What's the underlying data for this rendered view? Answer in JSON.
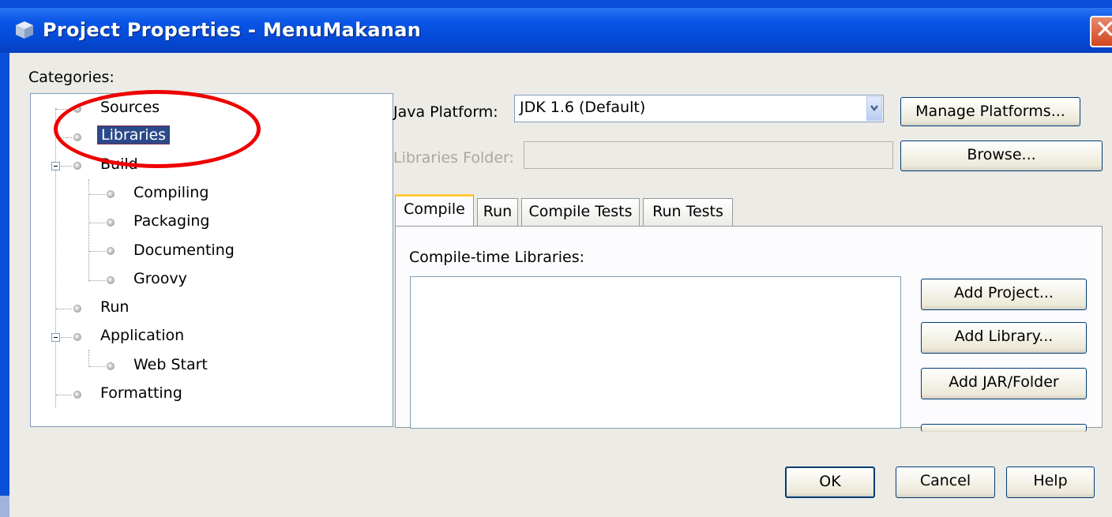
{
  "window": {
    "title": "Project Properties - MenuMakanan"
  },
  "categories": {
    "label": "Categories:",
    "items": [
      {
        "label": "Sources"
      },
      {
        "label": "Libraries",
        "selected": true
      },
      {
        "label": "Build"
      },
      {
        "label": "Compiling"
      },
      {
        "label": "Packaging"
      },
      {
        "label": "Documenting"
      },
      {
        "label": "Groovy"
      },
      {
        "label": "Run"
      },
      {
        "label": "Application"
      },
      {
        "label": "Web Start"
      },
      {
        "label": "Formatting"
      }
    ]
  },
  "java_platform": {
    "label": "Java Platform:",
    "value": "JDK 1.6 (Default)",
    "manage_button": "Manage Platforms..."
  },
  "libraries_folder": {
    "label": "Libraries Folder:",
    "value": "",
    "browse_button": "Browse..."
  },
  "tabs": [
    {
      "label": "Compile",
      "active": true
    },
    {
      "label": "Run"
    },
    {
      "label": "Compile Tests"
    },
    {
      "label": "Run Tests"
    }
  ],
  "compile_libraries": {
    "label": "Compile-time Libraries:",
    "add_project": "Add Project...",
    "add_library": "Add Library...",
    "add_jar": "Add JAR/Folder"
  },
  "footer": {
    "ok": "OK",
    "cancel": "Cancel",
    "help": "Help"
  },
  "colors": {
    "titlebar": "#0a56e6",
    "selection": "#2b4a8a",
    "annotation_circle": "#e00000"
  }
}
